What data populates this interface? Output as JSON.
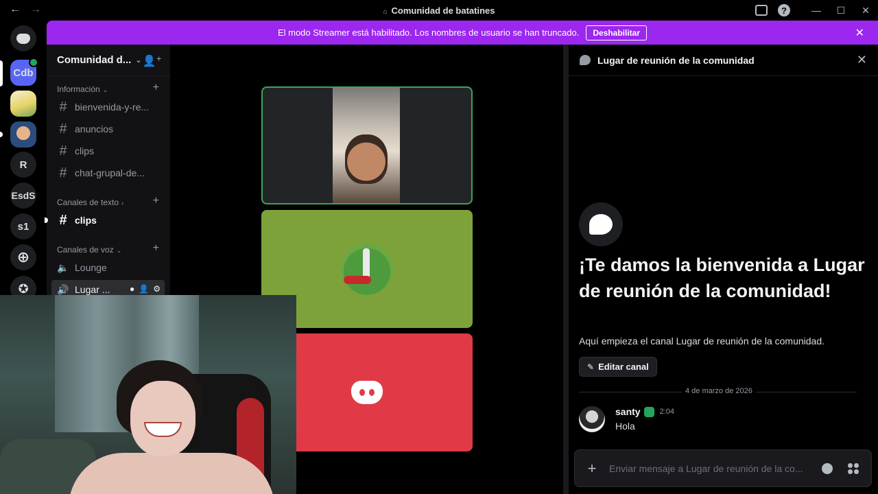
{
  "window": {
    "title": "Comunidad de batatines",
    "title_icon": "discord-small-icon"
  },
  "banner": {
    "text": "El modo Streamer está habilitado. Los nombres de usuario se han truncado.",
    "button": "Deshabilitar",
    "color": "#9c27ee"
  },
  "rail": {
    "servers": [
      {
        "label": "Cdb",
        "selected": true,
        "has_badge": true
      },
      {
        "label": "",
        "kind": "image"
      },
      {
        "label": "",
        "kind": "image"
      },
      {
        "label": "R"
      },
      {
        "label": "EsdS"
      },
      {
        "label": "s1"
      }
    ]
  },
  "sidebar": {
    "guild_name": "Comunidad d...",
    "categories": {
      "info": "Información",
      "text": "Canales de texto",
      "voice": "Canales de voz"
    },
    "info_channels": [
      "bienvenida-y-re...",
      "anuncios",
      "clips",
      "chat-grupal-de..."
    ],
    "text_channels": [
      "clips"
    ],
    "voice_channels": [
      "Lounge",
      "Lugar ..."
    ]
  },
  "chat": {
    "header_title": "Lugar de reunión de la comunidad",
    "welcome_title": "¡Te damos la bienvenida a Lugar de reunión de la comunidad!",
    "welcome_sub": "Aquí empieza el canal Lugar de reunión de la comunidad.",
    "edit_button": "Editar canal",
    "date_separator": "4 de marzo de 2026",
    "message": {
      "author": "santy",
      "time": "2:04",
      "text": "Hola"
    },
    "input_placeholder": "Enviar mensaje a Lugar de reunión de la co..."
  },
  "colors": {
    "accent": "#5865f2",
    "speaking": "#3ba55c",
    "avatar_red": "#e03a46",
    "avatar_green": "#7ea23a"
  }
}
